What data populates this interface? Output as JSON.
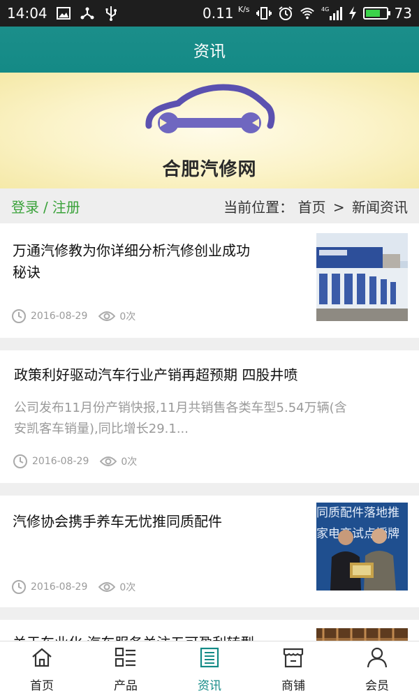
{
  "status_bar": {
    "time": "14:04",
    "speed": "0.11",
    "speed_unit": "K/s",
    "network": "4G",
    "battery": "73",
    "battery_level": 0.73,
    "icons": [
      "image-icon",
      "usb-share-icon",
      "usb-icon",
      "vibrate-icon",
      "alarm-icon",
      "wifi-icon",
      "signal-icon",
      "charging-icon",
      "battery-icon"
    ]
  },
  "header": {
    "title": "资讯"
  },
  "banner": {
    "logo_text": "合肥汽修网",
    "accent": "#5b51b0"
  },
  "breadcrumb": {
    "login": "登录",
    "separator": "/",
    "register": "注册",
    "position_label": "当前位置：",
    "home": "首页",
    "arrow": ">",
    "current": "新闻资讯"
  },
  "news": [
    {
      "title_line1": "万通汽修教为你详细分析汽修创业成功",
      "title_line2": "秘诀",
      "date": "2016-08-29",
      "views": "0次"
    },
    {
      "title_line1": "政策利好驱动汽车行业产销再超预期 四股井喷",
      "summary_line1": "公司发布11月份产销快报,11月共销售各类车型5.54万辆(含",
      "summary_line2": "安凯客车销量),同比增长29.1...",
      "date": "2016-08-29",
      "views": "0次"
    },
    {
      "title_line1": "汽修协会携手养车无忧推同质配件",
      "thumb_text_line1": "同质配件落地推",
      "thumb_text_line2": "家电商试点授牌",
      "date": "2016-08-29",
      "views": "0次"
    },
    {
      "title_line1": "关于车业化·汽车服务关注五可盈利转型"
    }
  ],
  "bottom_nav": [
    {
      "label": "首页",
      "icon": "home-icon"
    },
    {
      "label": "产品",
      "icon": "product-list-icon"
    },
    {
      "label": "资讯",
      "icon": "news-icon",
      "active": true
    },
    {
      "label": "商铺",
      "icon": "shop-icon"
    },
    {
      "label": "会员",
      "icon": "member-icon"
    }
  ],
  "colors": {
    "primary": "#148a86",
    "login_green": "#3aa23a",
    "status_bar": "#1e1e1e"
  }
}
